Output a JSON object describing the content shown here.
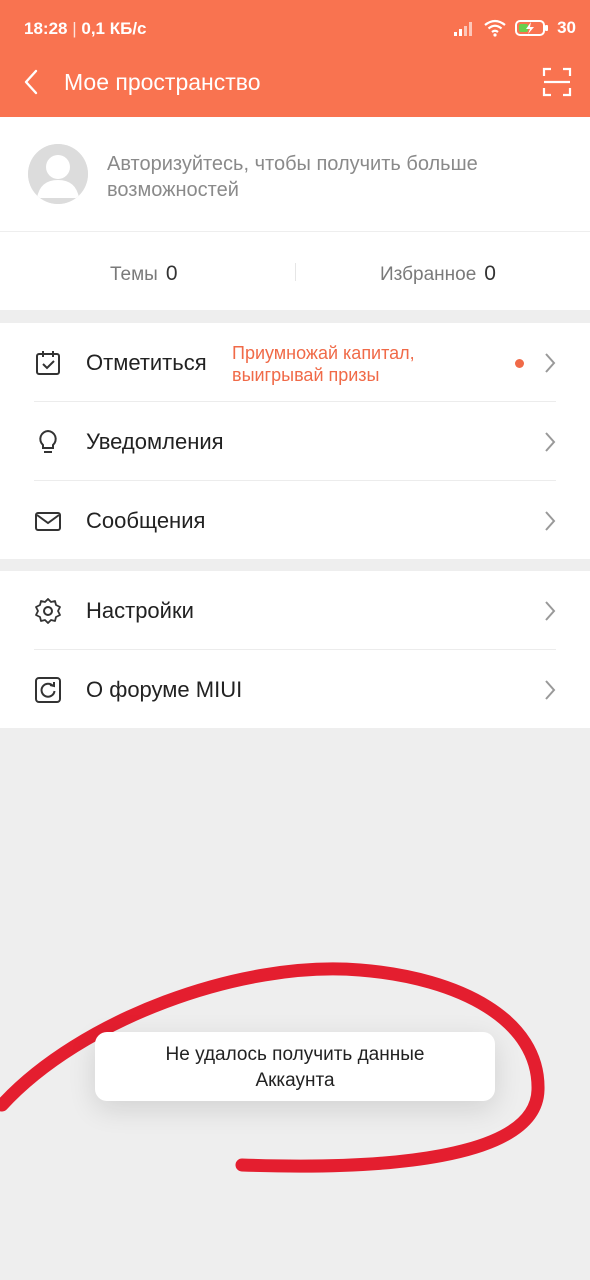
{
  "status_bar": {
    "time": "18:28",
    "separator": "|",
    "speed": "0,1 КБ/с",
    "battery": "30"
  },
  "app_bar": {
    "title": "Мое пространство"
  },
  "profile": {
    "login_prompt": "Авторизуйтесь, чтобы получить больше возможностей"
  },
  "stats": {
    "themes_label": "Темы",
    "themes_count": "0",
    "favorites_label": "Избранное",
    "favorites_count": "0"
  },
  "menu_group_1": [
    {
      "label": "Отметиться",
      "promo_line1": "Приумножай капитал,",
      "promo_line2": "выигрывай призы",
      "icon": "calendar-check-icon"
    },
    {
      "label": "Уведомления",
      "icon": "lightbulb-icon"
    },
    {
      "label": "Сообщения",
      "icon": "envelope-icon"
    }
  ],
  "menu_group_2": [
    {
      "label": "Настройки",
      "icon": "gear-icon"
    },
    {
      "label": "О форуме MIUI",
      "icon": "refresh-square-icon"
    }
  ],
  "toast": {
    "line1": "Не удалось получить данные",
    "line2": "Аккаунта"
  },
  "colors": {
    "accent": "#f97350",
    "promo": "#f06a48",
    "annotation": "#e41e2f"
  }
}
